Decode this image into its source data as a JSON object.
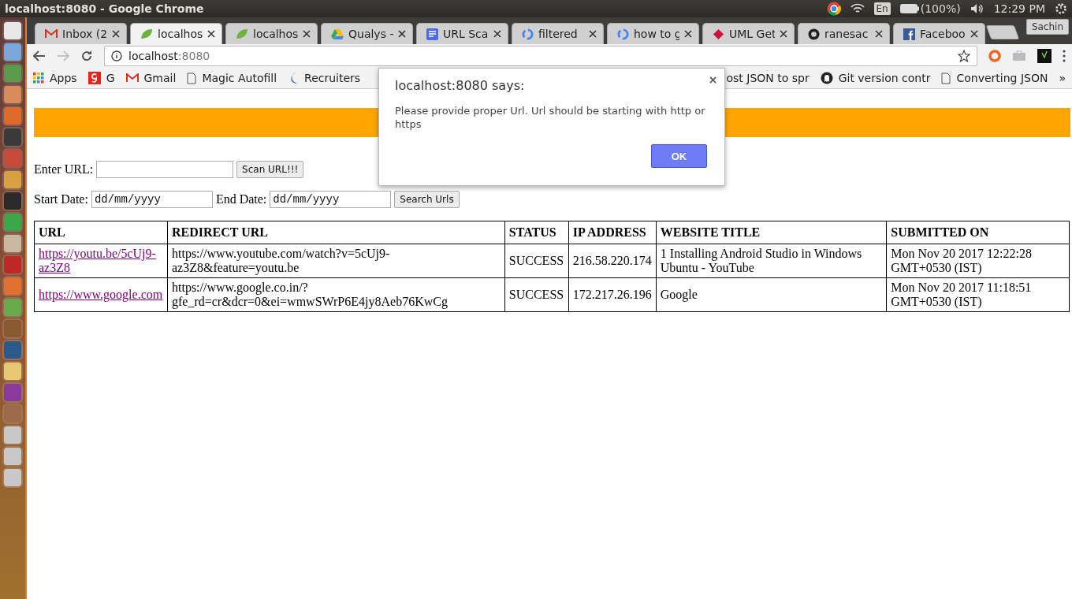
{
  "top_panel": {
    "window_title": "localhost:8080 - Google Chrome",
    "keyboard": "En",
    "battery": "(100%)",
    "clock": "12:29 PM"
  },
  "tabs": [
    {
      "label": "Inbox (2",
      "kind": "gmail",
      "selected": false
    },
    {
      "label": "localhos",
      "kind": "leaf",
      "selected": true
    },
    {
      "label": "localhos",
      "kind": "leaf",
      "selected": false
    },
    {
      "label": "Qualys -",
      "kind": "drive",
      "selected": false
    },
    {
      "label": "URL Sca",
      "kind": "docs",
      "selected": false
    },
    {
      "label": "filtered",
      "kind": "google",
      "selected": false
    },
    {
      "label": "how to g",
      "kind": "google",
      "selected": false
    },
    {
      "label": "UML Get",
      "kind": "uml",
      "selected": false
    },
    {
      "label": "ranesac",
      "kind": "github",
      "selected": false
    },
    {
      "label": "Faceboo",
      "kind": "facebook",
      "selected": false
    }
  ],
  "profile": "Sachin",
  "address_bar": {
    "host": "localhost",
    "port": ":8080"
  },
  "bookmarks": [
    {
      "label": "Apps",
      "kind": "apps"
    },
    {
      "label": "G",
      "kind": "g"
    },
    {
      "label": "Gmail",
      "kind": "gmail"
    },
    {
      "label": "Magic Autofill",
      "kind": "page"
    },
    {
      "label": "Recruiters",
      "kind": "moon"
    }
  ],
  "bookmarks_right": [
    {
      "label": "ost JSON to spr",
      "kind": "none"
    },
    {
      "label": "Git version contr",
      "kind": "ghost"
    },
    {
      "label": "Converting JSON",
      "kind": "page"
    }
  ],
  "bookmarks_more": "»",
  "page": {
    "url_label": "Enter URL:",
    "scan_button": "Scan URL!!!",
    "start_label": "Start Date:",
    "start_placeholder": "dd/mm/yyyy",
    "end_label": "End Date:",
    "end_placeholder": "dd/mm/yyyy",
    "search_button": "Search Urls",
    "table": {
      "columns": [
        "URL",
        "REDIRECT URL",
        "STATUS",
        "IP ADDRESS",
        "WEBSITE TITLE",
        "SUBMITTED ON"
      ],
      "rows": [
        {
          "cells": [
            "https://youtu.be/5cUj9-az3Z8",
            "https://www.youtube.com/watch?v=5cUj9-az3Z8&feature=youtu.be",
            "SUCCESS",
            "216.58.220.174",
            "1 Installing Android Studio in Windows Ubuntu - YouTube",
            "Mon Nov 20 2017 12:22:28 GMT+0530 (IST)"
          ]
        },
        {
          "cells": [
            "https://www.google.com",
            "https://www.google.co.in/?gfe_rd=cr&dcr=0&ei=wmwSWrP6E4jy8Aeb76KwCg",
            "SUCCESS",
            "172.217.26.196",
            "Google",
            "Mon Nov 20 2017 11:18:51 GMT+0530 (IST)"
          ]
        }
      ]
    }
  },
  "dialog": {
    "title": "localhost:8080 says:",
    "message": "Please provide proper Url. Url should be starting with http or https",
    "ok": "OK"
  }
}
